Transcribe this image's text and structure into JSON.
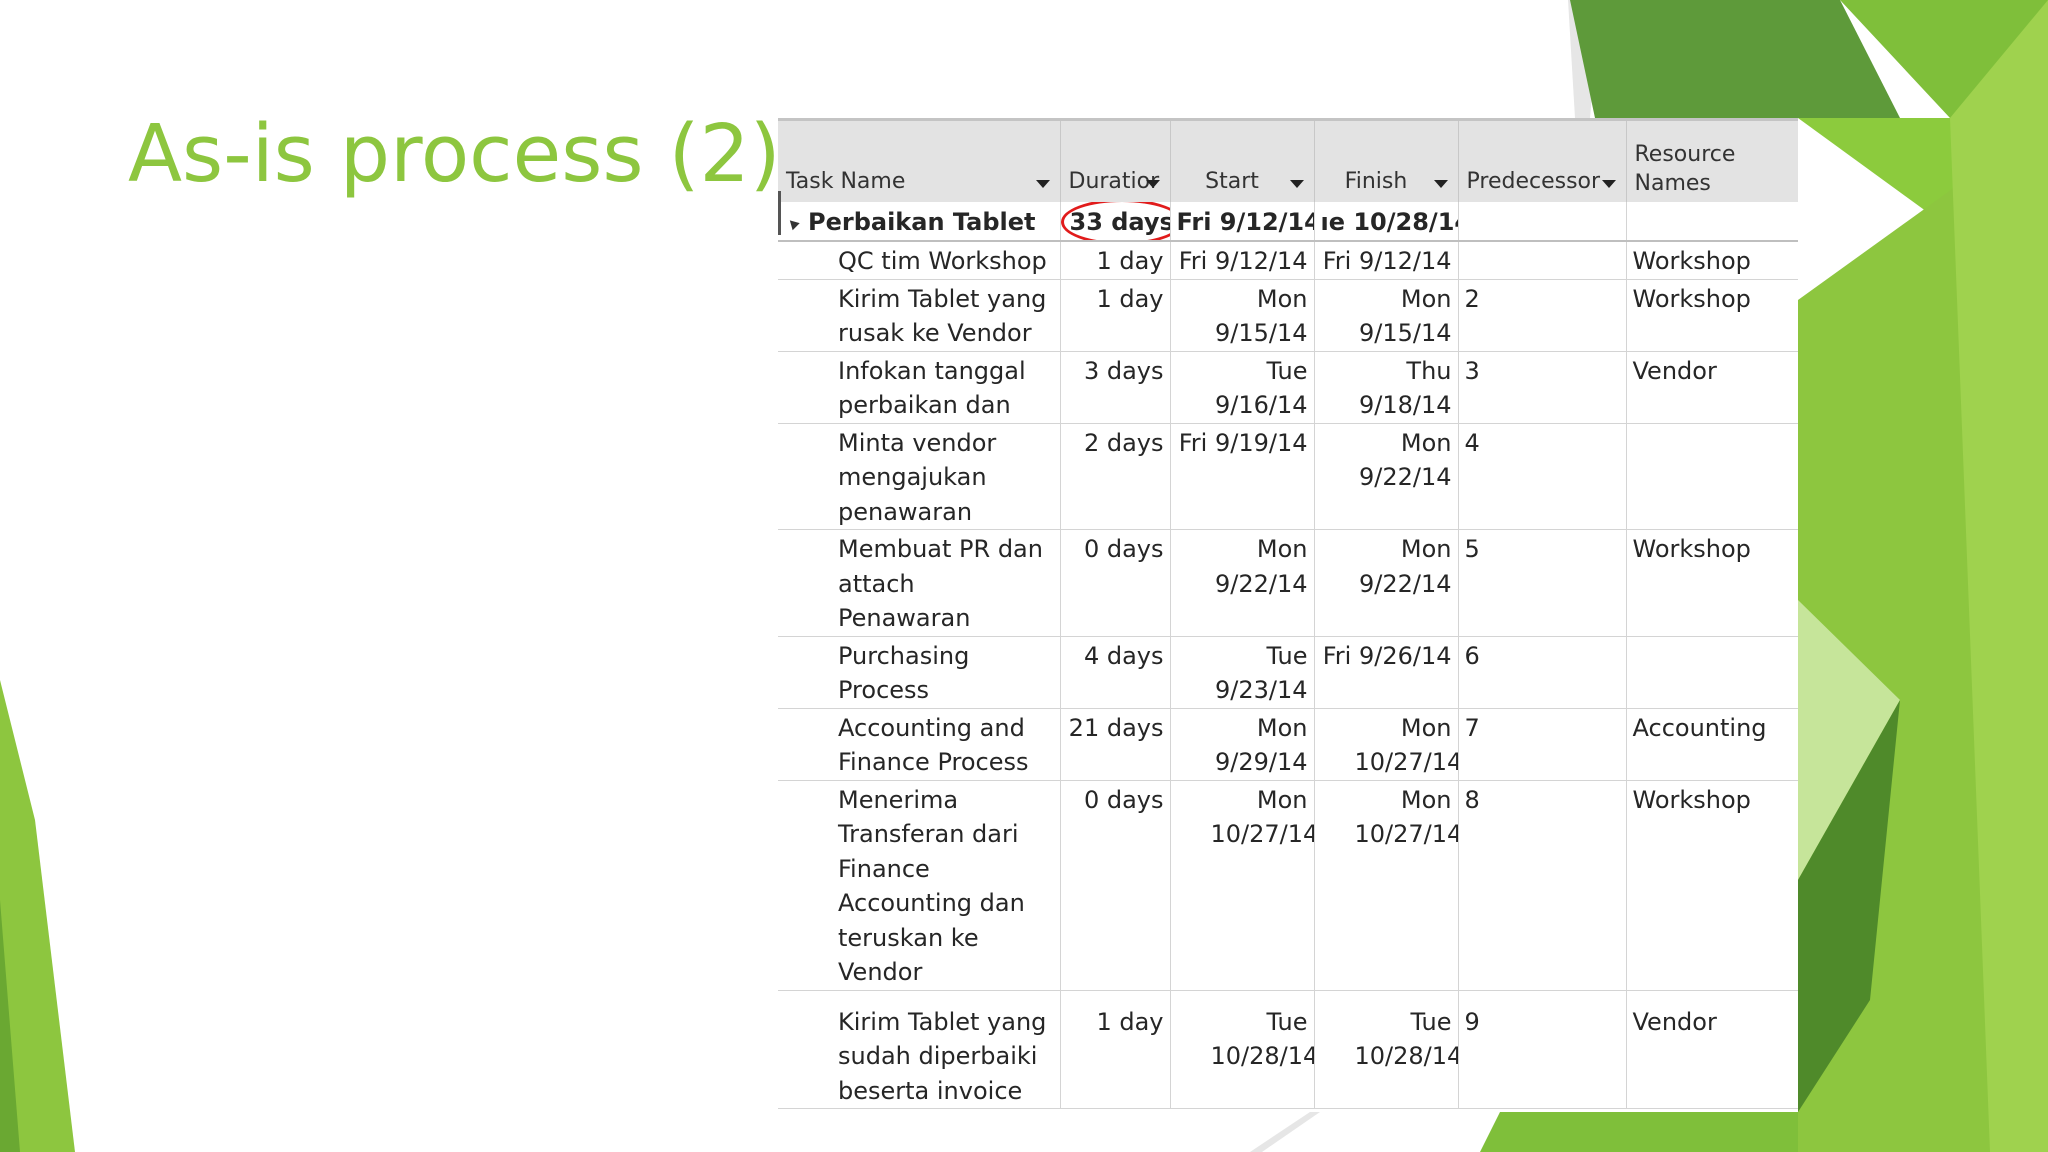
{
  "slide": {
    "title": "As-is process (2)",
    "accent_color": "#8dc63f"
  },
  "table": {
    "headers": {
      "task_name": "Task Name",
      "duration": "Duratior",
      "start": "Start",
      "finish": "Finish",
      "predecessor": "Predecessor",
      "resource_names": "Resource Names"
    },
    "summary": {
      "task": "Perbaikan Tablet",
      "duration": "33 days",
      "start": "Fri 9/12/14",
      "finish": "ıe 10/28/14"
    },
    "rows": [
      {
        "task": "QC tim Workshop",
        "duration": "1 day",
        "start": "Fri 9/12/14",
        "finish": "Fri 9/12/14",
        "pred": "",
        "resource": "Workshop"
      },
      {
        "task": "Kirim Tablet yang rusak ke Vendor",
        "duration": "1 day",
        "start": "Mon 9/15/14",
        "finish": "Mon 9/15/14",
        "pred": "2",
        "resource": "Workshop"
      },
      {
        "task": "Infokan tanggal perbaikan dan",
        "duration": "3 days",
        "start": "Tue 9/16/14",
        "finish": "Thu 9/18/14",
        "pred": "3",
        "resource": "Vendor"
      },
      {
        "task": "Minta vendor mengajukan penawaran",
        "duration": "2 days",
        "start": "Fri 9/19/14",
        "finish": "Mon 9/22/14",
        "pred": "4",
        "resource": ""
      },
      {
        "task": "Membuat PR dan attach Penawaran",
        "duration": "0 days",
        "start": "Mon 9/22/14",
        "finish": "Mon 9/22/14",
        "pred": "5",
        "resource": "Workshop"
      },
      {
        "task": "Purchasing Process",
        "duration": "4 days",
        "start": "Tue 9/23/14",
        "finish": "Fri 9/26/14",
        "pred": "6",
        "resource": ""
      },
      {
        "task": "Accounting and Finance Process",
        "duration": "21 days",
        "start": "Mon 9/29/14",
        "finish": "Mon 10/27/14",
        "pred": "7",
        "resource": "Accounting"
      },
      {
        "task": "Menerima Transferan dari Finance Accounting dan teruskan ke Vendor",
        "duration": "0 days",
        "start": "Mon 10/27/14",
        "finish": "Mon 10/27/14",
        "pred": "8",
        "resource": "Workshop"
      },
      {
        "task": "Kirim Tablet yang sudah diperbaiki beserta invoice",
        "duration": "1 day",
        "start": "Tue 10/28/14",
        "finish": "Tue 10/28/14",
        "pred": "9",
        "resource": "Vendor"
      }
    ]
  }
}
